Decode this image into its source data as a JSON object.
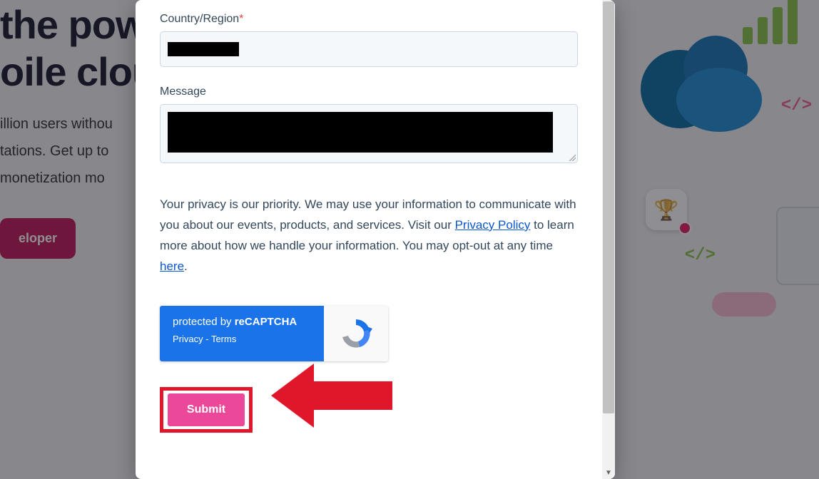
{
  "background": {
    "headline_line1": "the pow",
    "headline_line2": "oile cloud",
    "sub_line1": "illion users withou",
    "sub_line2": "tations. Get up to",
    "sub_line3": "monetization mo",
    "button": "eloper"
  },
  "form": {
    "country_label": "Country/Region",
    "required_mark": "*",
    "country_value": "",
    "message_label": "Message",
    "message_value": ""
  },
  "privacy": {
    "text_1": "Your privacy is our priority. We may use your information to communicate with you about our events, products, and services. Visit our ",
    "link_1": "Privacy Policy",
    "text_2": " to learn more about how we handle your information. You may opt-out at any time ",
    "link_2": "here",
    "text_3": "."
  },
  "recaptcha": {
    "protected_by": "protected by ",
    "brand": "reCAPTCHA",
    "privacy": "Privacy",
    "sep": " - ",
    "terms": "Terms"
  },
  "submit_label": "Submit"
}
